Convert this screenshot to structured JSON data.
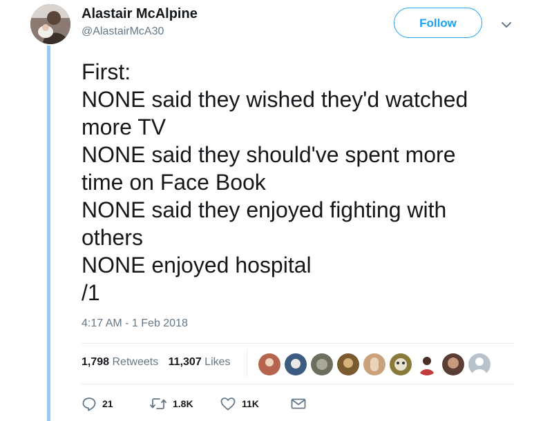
{
  "author": {
    "name": "Alastair McAlpine",
    "handle": "@AlastairMcA30"
  },
  "follow_label": "Follow",
  "tweet_lines": [
    "First:",
    "NONE said they wished they'd watched",
    "more TV",
    "NONE said they should've spent more",
    "time on Face Book",
    "NONE said they enjoyed fighting with",
    "others",
    "NONE enjoyed hospital",
    "/1"
  ],
  "timestamp": "4:17 AM - 1 Feb 2018",
  "stats": {
    "retweets_count": "1,798",
    "retweets_label": "Retweets",
    "likes_count": "11,307",
    "likes_label": "Likes"
  },
  "likers": [
    {
      "name": "liker-1",
      "color": "#b5654f"
    },
    {
      "name": "liker-2",
      "color": "#3d5a80"
    },
    {
      "name": "liker-3",
      "color": "#6e6e5e"
    },
    {
      "name": "liker-4",
      "color": "#7a5a2f"
    },
    {
      "name": "liker-5",
      "color": "#c9a27c"
    },
    {
      "name": "liker-6",
      "color": "#8a7a3a"
    },
    {
      "name": "liker-7",
      "color": "#c23b3b"
    },
    {
      "name": "liker-8",
      "color": "#5a3e36"
    },
    {
      "name": "liker-9",
      "color": "#b8c2cc"
    }
  ],
  "actions": {
    "reply_count": "21",
    "retweet_count": "1.8K",
    "like_count": "11K"
  },
  "colors": {
    "accent": "#1da1f2",
    "thread_line": "#9ec9ee",
    "secondary_text": "#657786",
    "divider": "#e6ecf0"
  }
}
